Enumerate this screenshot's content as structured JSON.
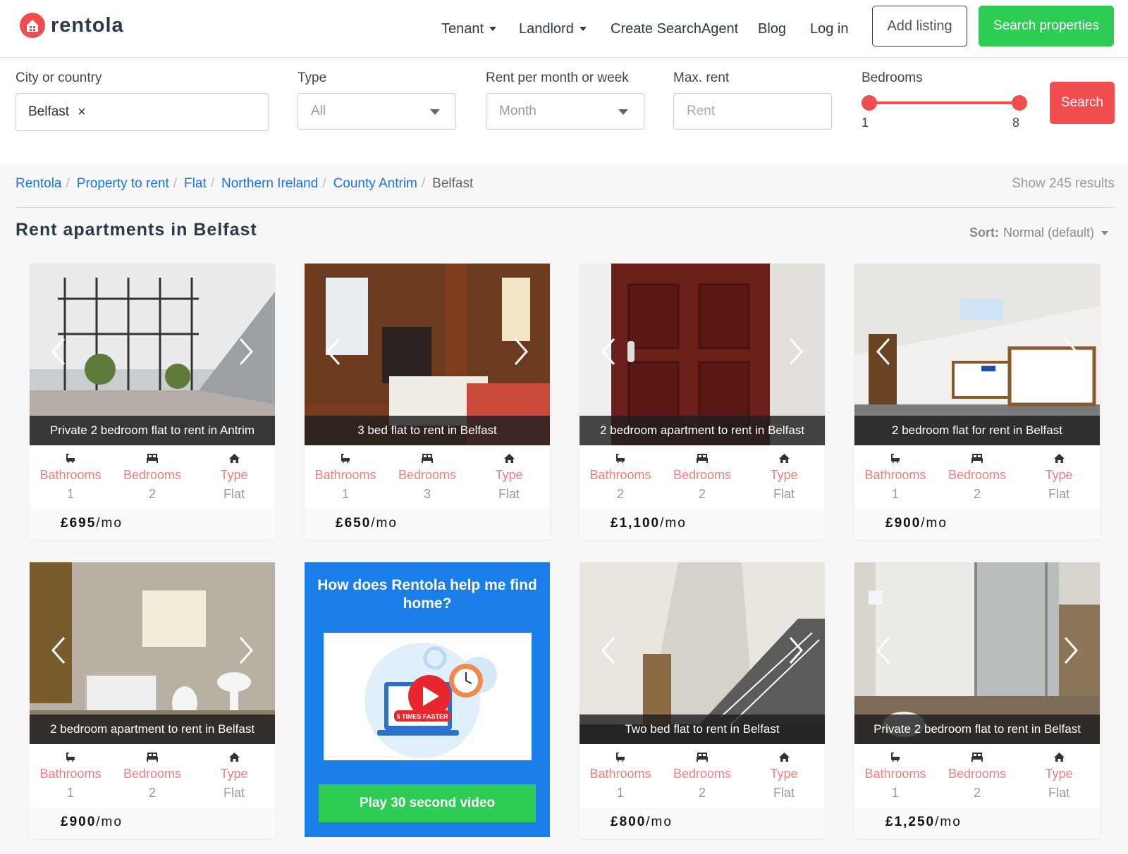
{
  "header": {
    "logo_text": "rentola",
    "nav": {
      "tenant": "Tenant",
      "landlord": "Landlord",
      "create_agent": "Create SearchAgent",
      "blog": "Blog",
      "login": "Log in"
    },
    "add_listing": "Add listing",
    "search_properties": "Search properties"
  },
  "filters": {
    "city_label": "City or country",
    "city_value": "Belfast",
    "city_clear": "×",
    "type_label": "Type",
    "type_value": "All",
    "period_label": "Rent per month or week",
    "period_value": "Month",
    "max_rent_label": "Max. rent",
    "max_rent_placeholder": "Rent",
    "bedrooms_label": "Bedrooms",
    "bedrooms_min": "1",
    "bedrooms_max": "8",
    "search_button": "Search"
  },
  "breadcrumb": {
    "items": [
      "Rentola",
      "Property to rent",
      "Flat",
      "Northern Ireland",
      "County Antrim"
    ],
    "current": "Belfast",
    "separator": "/"
  },
  "results_text": "Show 245 results",
  "page_title": "Rent apartments in Belfast",
  "sort": {
    "label": "Sort:",
    "value": "Normal (default)"
  },
  "stat_labels": {
    "bathrooms": "Bathrooms",
    "bedrooms": "Bedrooms",
    "type": "Type"
  },
  "listings": [
    {
      "title": "Private 2 bedroom flat to rent in Antrim",
      "bathrooms": "1",
      "bedrooms": "2",
      "type": "Flat",
      "price": "£695",
      "unit": "/mo"
    },
    {
      "title": "3 bed flat to rent in Belfast",
      "bathrooms": "1",
      "bedrooms": "3",
      "type": "Flat",
      "price": "£650",
      "unit": "/mo"
    },
    {
      "title": "2 bedroom apartment to rent in Belfast",
      "bathrooms": "2",
      "bedrooms": "2",
      "type": "Flat",
      "price": "£1,100",
      "unit": "/mo"
    },
    {
      "title": "2 bedroom flat for rent in Belfast",
      "bathrooms": "1",
      "bedrooms": "2",
      "type": "Flat",
      "price": "£900",
      "unit": "/mo"
    },
    {
      "title": "2 bedroom apartment to rent in Belfast",
      "bathrooms": "1",
      "bedrooms": "2",
      "type": "Flat",
      "price": "£900",
      "unit": "/mo"
    },
    {
      "title": "Two bed flat to rent in Belfast",
      "bathrooms": "1",
      "bedrooms": "2",
      "type": "Flat",
      "price": "£800",
      "unit": "/mo"
    },
    {
      "title": "Private 2 bedroom flat to rent in Belfast",
      "bathrooms": "1",
      "bedrooms": "2",
      "type": "Flat",
      "price": "£1,250",
      "unit": "/mo"
    }
  ],
  "promo": {
    "title": "How does Rentola help me find home?",
    "video_caption": "5 TIMES FASTER",
    "button": "Play 30 second video"
  },
  "colors": {
    "brand_red": "#f04e4e",
    "green": "#2ecc55",
    "link_blue": "#1a73e8",
    "promo_blue": "#1a7ee8"
  }
}
